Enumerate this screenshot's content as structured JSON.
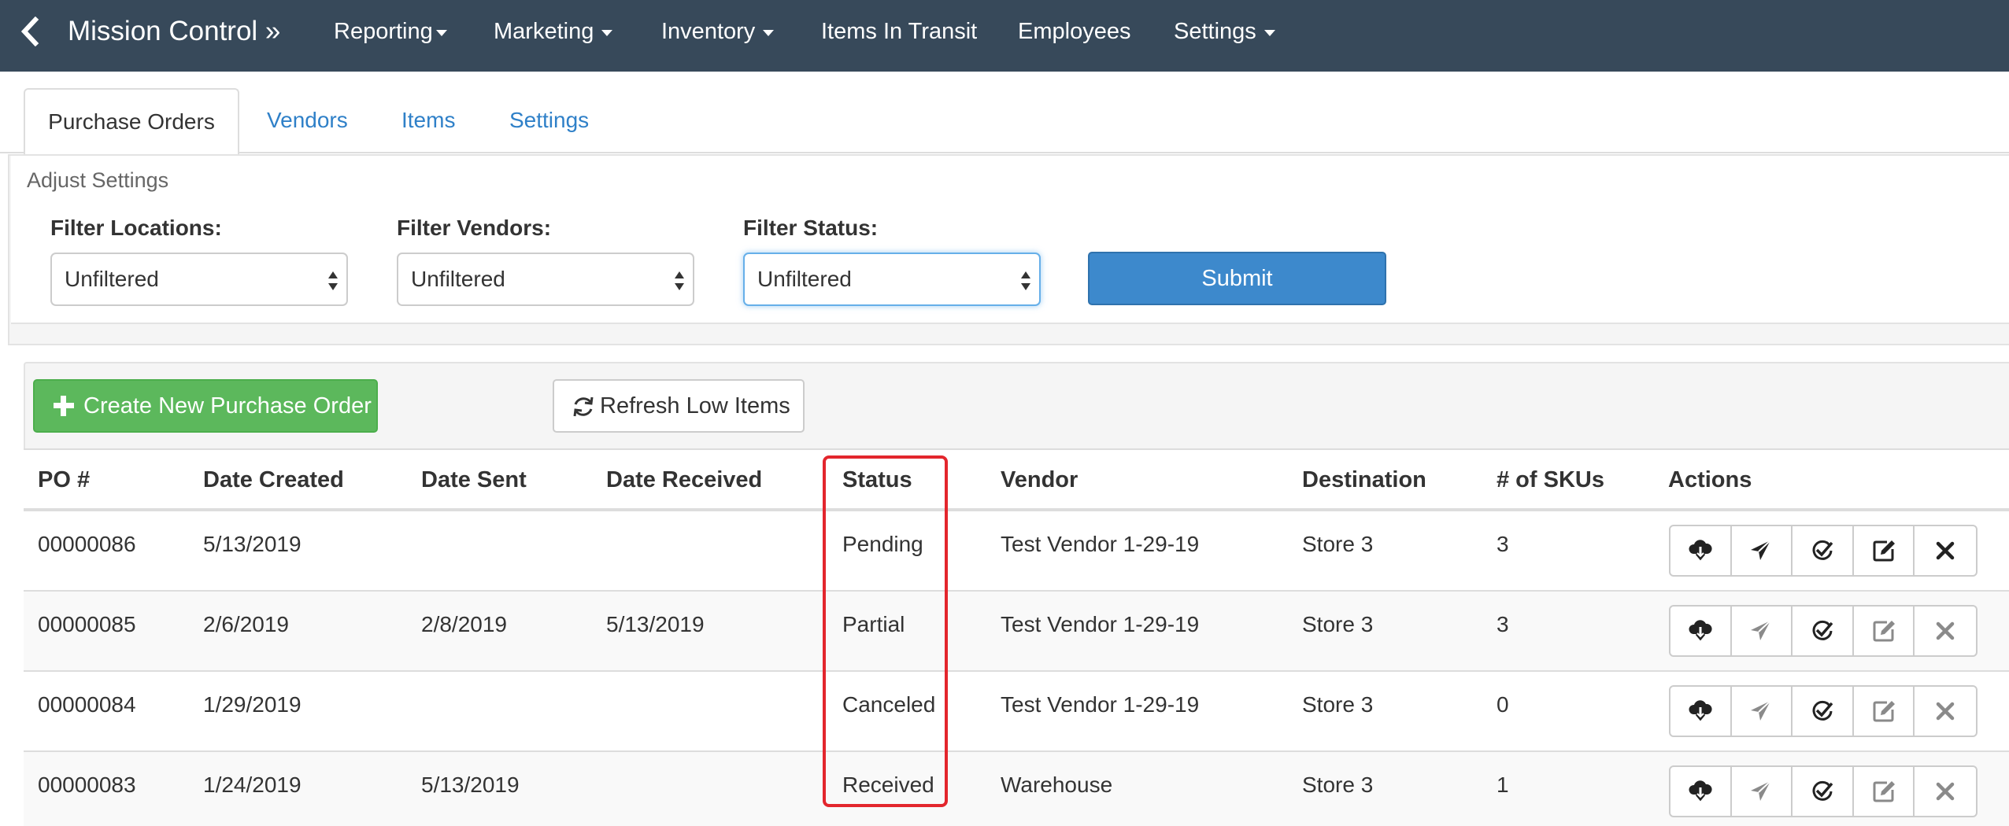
{
  "nav": {
    "brand": "Mission Control »",
    "items": [
      {
        "label": "Reporting",
        "dropdown": true
      },
      {
        "label": "Marketing",
        "dropdown": true
      },
      {
        "label": "Inventory",
        "dropdown": true
      },
      {
        "label": "Items In Transit",
        "dropdown": false
      },
      {
        "label": "Employees",
        "dropdown": false
      },
      {
        "label": "Settings",
        "dropdown": true
      }
    ],
    "back_icon": "chevron-left-icon"
  },
  "tabs": [
    {
      "label": "Purchase Orders",
      "active": true
    },
    {
      "label": "Vendors",
      "active": false
    },
    {
      "label": "Items",
      "active": false
    },
    {
      "label": "Settings",
      "active": false
    }
  ],
  "settings_panel": {
    "title": "Adjust Settings",
    "filters": [
      {
        "label": "Filter Locations:",
        "value": "Unfiltered"
      },
      {
        "label": "Filter Vendors:",
        "value": "Unfiltered"
      },
      {
        "label": "Filter Status:",
        "value": "Unfiltered"
      }
    ],
    "submit_label": "Submit"
  },
  "toolbar": {
    "create_label": "Create New Purchase Order",
    "refresh_label": "Refresh Low Items"
  },
  "table": {
    "columns": [
      "PO #",
      "Date Created",
      "Date Sent",
      "Date Received",
      "Status",
      "Vendor",
      "Destination",
      "# of SKUs",
      "Actions"
    ],
    "rows": [
      {
        "po": "00000086",
        "created": "5/13/2019",
        "sent": "",
        "received": "",
        "status": "Pending",
        "vendor": "Test Vendor 1-29-19",
        "destination": "Store 3",
        "skus": "3",
        "actions_enabled": true
      },
      {
        "po": "00000085",
        "created": "2/6/2019",
        "sent": "2/8/2019",
        "received": "5/13/2019",
        "status": "Partial",
        "vendor": "Test Vendor 1-29-19",
        "destination": "Store 3",
        "skus": "3",
        "actions_enabled": false
      },
      {
        "po": "00000084",
        "created": "1/29/2019",
        "sent": "",
        "received": "",
        "status": "Canceled",
        "vendor": "Test Vendor 1-29-19",
        "destination": "Store 3",
        "skus": "0",
        "actions_enabled": false
      },
      {
        "po": "00000083",
        "created": "1/24/2019",
        "sent": "5/13/2019",
        "received": "",
        "status": "Received",
        "vendor": "Warehouse",
        "destination": "Store 3",
        "skus": "1",
        "actions_enabled": false
      }
    ],
    "action_icons": [
      "cloud-download-icon",
      "send-icon",
      "check-circle-icon",
      "edit-icon",
      "close-icon"
    ]
  },
  "colors": {
    "navbar": "#37495a",
    "link": "#2f80c8",
    "primary": "#3d89cc",
    "success": "#5cb85c",
    "highlight": "#e3262d",
    "action_active": "#222222",
    "action_disabled": "#8a8a8a"
  }
}
